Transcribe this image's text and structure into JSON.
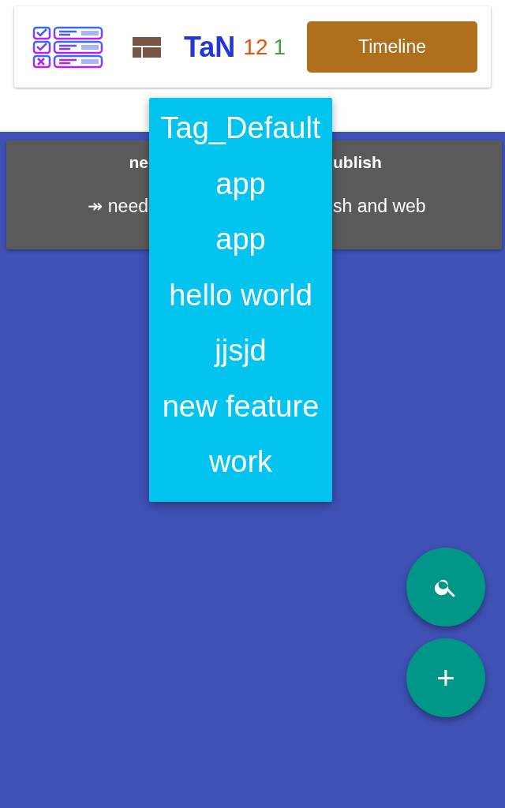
{
  "header": {
    "app_name": "TaN",
    "counts": [
      {
        "text": "12",
        "color": "#e65100"
      },
      {
        "text": "1",
        "color": "#43a047"
      }
    ],
    "timeline_button": "Timeline"
  },
  "note_card": {
    "title_parts": [
      "ne",
      "ublish"
    ],
    "body_parts": [
      "↠ need",
      "sh and web"
    ]
  },
  "tag_menu": {
    "items": [
      {
        "label": "Tag_Default"
      },
      {
        "label": "app"
      },
      {
        "label": "app"
      },
      {
        "label": "hello world"
      },
      {
        "label": "jjsjd"
      },
      {
        "label": "new feature"
      },
      {
        "label": "work"
      }
    ]
  },
  "fabs": [
    {
      "kind": "search"
    },
    {
      "kind": "add",
      "label": "+"
    }
  ]
}
